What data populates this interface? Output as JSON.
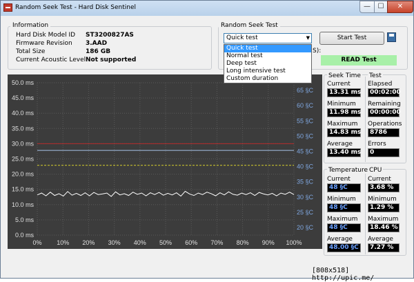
{
  "window": {
    "title": "Random Seek Test - Hard Disk Sentinel",
    "minimize": "—",
    "maximize": "☐",
    "close": "✕"
  },
  "info": {
    "title": "Information",
    "rows": [
      {
        "label": "Hard Disk Model ID",
        "value": "ST3200827AS"
      },
      {
        "label": "Firmware Revision",
        "value": "3.AAD"
      },
      {
        "label": "Total Size",
        "value": "186 GB"
      },
      {
        "label": "Current Acoustic Level",
        "value": "Not supported"
      }
    ]
  },
  "seek": {
    "title": "Random Seek Test",
    "selected": "Quick test",
    "options": [
      "Quick test",
      "Normal test",
      "Deep test",
      "Long intensive test",
      "Custom duration"
    ],
    "start_label": "Start Test",
    "partial_label": "S):",
    "status": "READ Test"
  },
  "chart_data": {
    "type": "line",
    "left_ticks": [
      "50.0 ms",
      "45.0 ms",
      "40.0 ms",
      "35.0 ms",
      "30.0 ms",
      "25.0 ms",
      "20.0 ms",
      "15.0 ms",
      "10.0 ms",
      "5.0 ms",
      "0.0 ms"
    ],
    "right_ticks": [
      "65 §C",
      "60 §C",
      "55 §C",
      "50 §C",
      "45 §C",
      "40 §C",
      "35 §C",
      "30 §C",
      "25 §C",
      "20 §C"
    ],
    "x_ticks": [
      "0%",
      "10%",
      "20%",
      "30%",
      "40%",
      "50%",
      "60%",
      "70%",
      "80%",
      "90%",
      "100%"
    ],
    "ylim": [
      0,
      50
    ],
    "series": [
      {
        "values": [
          13.2,
          13.8,
          12.9,
          14.1,
          13.0,
          13.6,
          12.8,
          14.3,
          13.1,
          13.7,
          13.0,
          13.9,
          12.9,
          14.0,
          13.3,
          13.5,
          13.8,
          12.7,
          14.2,
          13.2,
          13.6,
          13.0,
          14.1,
          13.4,
          13.8,
          12.9,
          13.9,
          13.3,
          14.0,
          13.1,
          13.7,
          13.2,
          13.9,
          12.8,
          14.4,
          13.5,
          13.0,
          13.8,
          13.3,
          14.1,
          13.6,
          12.9,
          13.9,
          13.2,
          14.2,
          13.4,
          13.1,
          13.8,
          13.3,
          13.9,
          13.0,
          14.0,
          13.5,
          13.2,
          13.7,
          12.9,
          13.8,
          13.4,
          14.1,
          13.3
        ],
        "color": "#ffffff"
      }
    ],
    "thresholds": [
      {
        "value": 30.0,
        "color": "#b52a2a"
      },
      {
        "value": 27.8,
        "color": "#a8c4e8"
      },
      {
        "value": 22.9,
        "color": "#d8d02a"
      }
    ]
  },
  "seek_time": {
    "title": "Seek Time",
    "current_label": "Current",
    "current": "13.31 ms",
    "min_label": "Minimum",
    "min": "11.98 ms",
    "max_label": "Maximum",
    "max": "14.83 ms",
    "avg_label": "Average",
    "avg": "13.40 ms"
  },
  "test": {
    "title": "Test",
    "elapsed_label": "Elapsed",
    "elapsed": "00:02:00",
    "remaining_label": "Remaining",
    "remaining": "00:00:00",
    "operations_label": "Operations",
    "operations": "8786",
    "errors_label": "Errors",
    "errors": "0"
  },
  "temperature": {
    "title": "Temperature",
    "current_label": "Current",
    "current": "48 §C",
    "min_label": "Minimum",
    "min": "48 §C",
    "max_label": "Maximum",
    "max": "48 §C",
    "avg_label": "Average",
    "avg": "48.00 §C"
  },
  "cpu": {
    "title": "CPU",
    "current_label": "Current",
    "current": "3.68 %",
    "min_label": "Minimum",
    "min": "1.29 %",
    "max_label": "Maximum",
    "max": "18.46 %",
    "avg_label": "Average",
    "avg": "7.27 %"
  },
  "footer": "[808x518] http://upic.me/"
}
